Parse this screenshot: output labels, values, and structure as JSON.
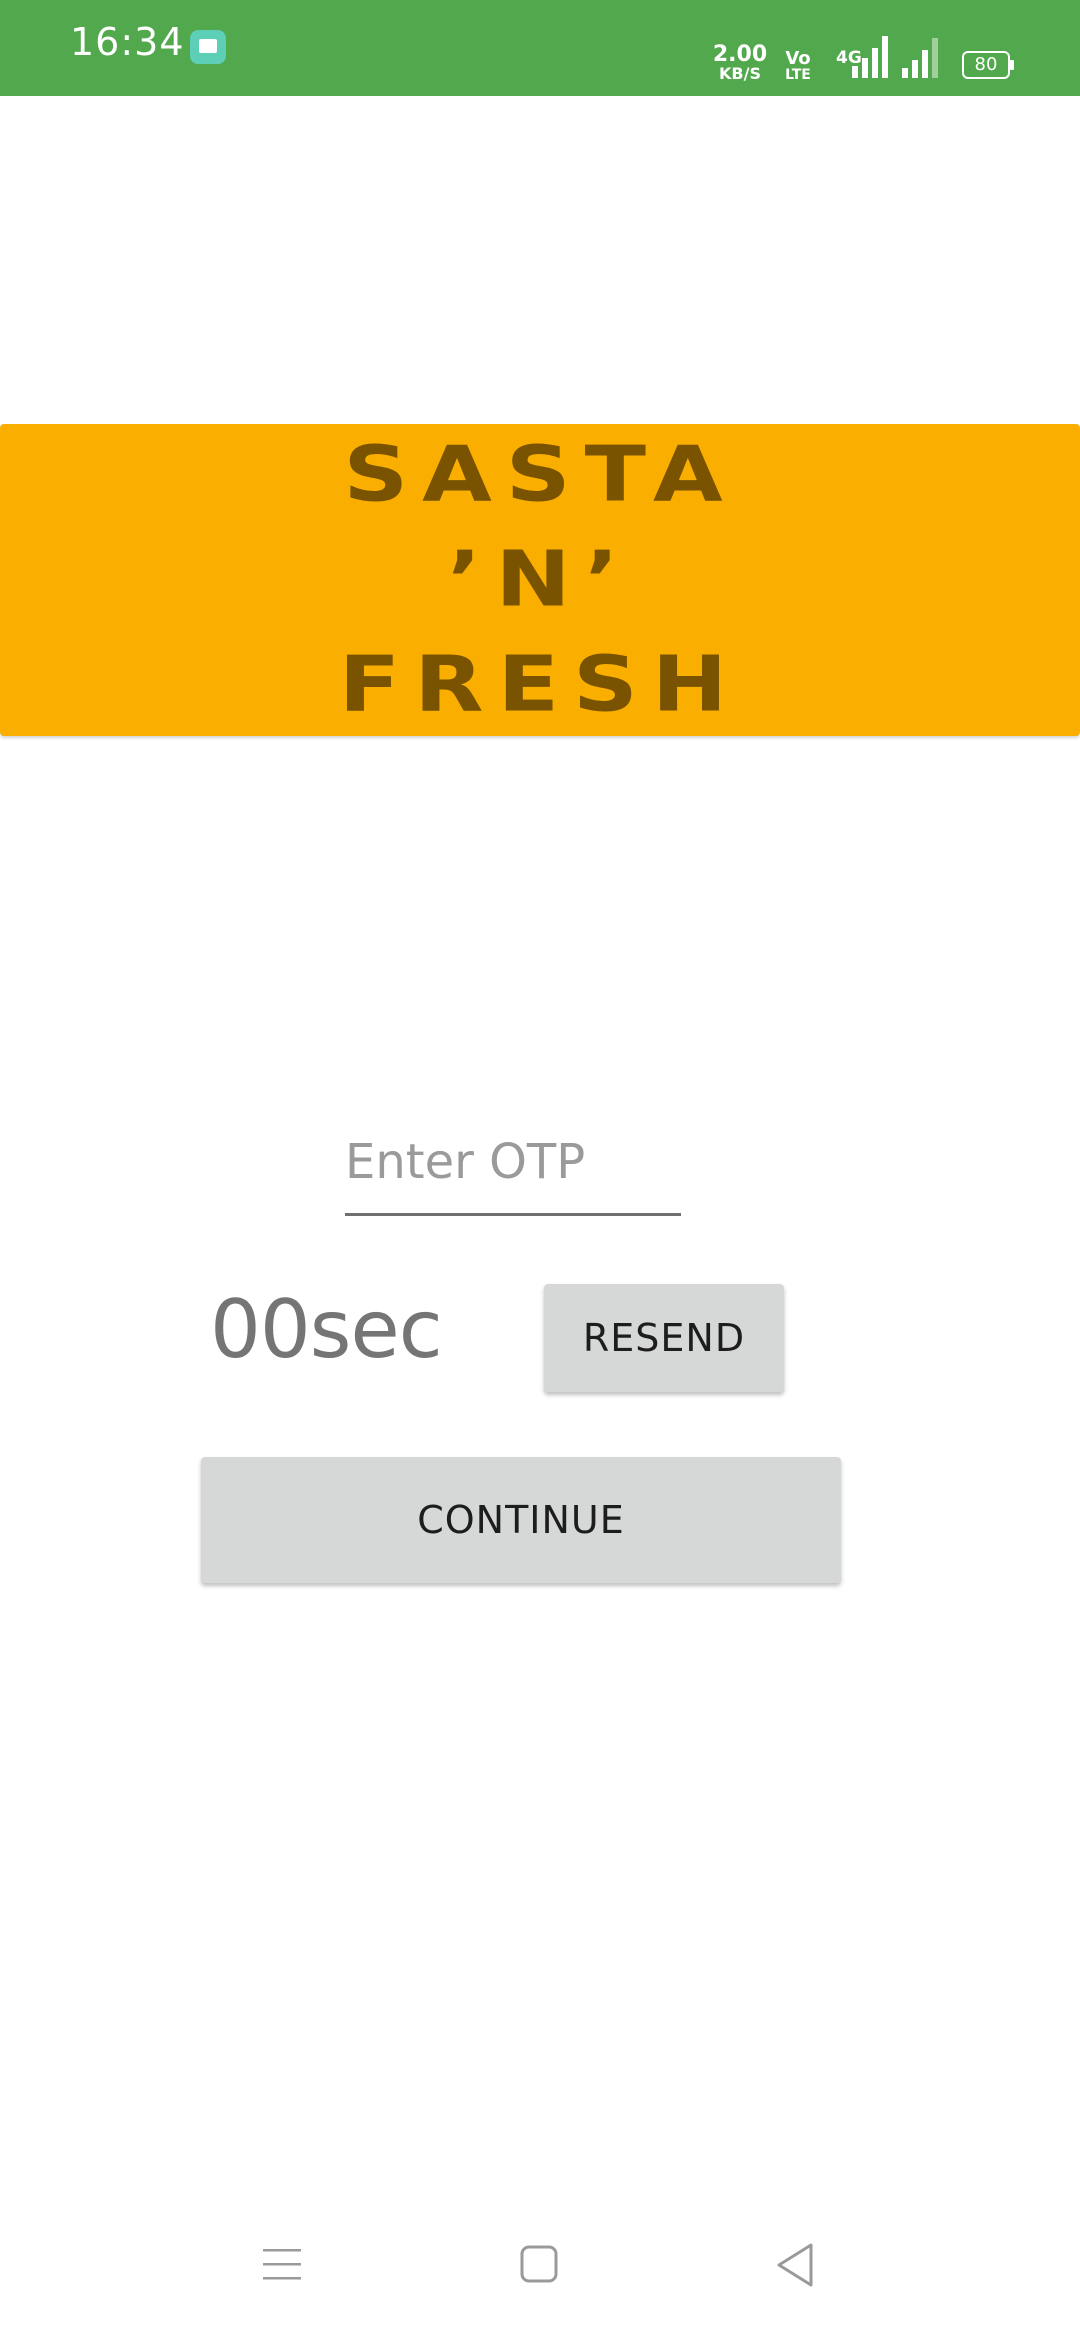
{
  "status_bar": {
    "time": "16:34",
    "net_speed_value": "2.00",
    "net_speed_unit": "KB/S",
    "volte_top": "Vo",
    "volte_bottom": "LTE",
    "network_type": "4G",
    "battery_level": "80",
    "color": "#52a84c"
  },
  "banner": {
    "line1": "SASTA",
    "line2": "’N’",
    "line3": "FRESH",
    "background_color": "#f9ae00",
    "text_color": "#7a5300"
  },
  "otp": {
    "placeholder": "Enter OTP",
    "value": ""
  },
  "timer": {
    "text": "00sec"
  },
  "buttons": {
    "resend_label": "RESEND",
    "continue_label": "CONTINUE",
    "color": "#d6d7d7"
  },
  "nav": {
    "icons": [
      "menu-icon",
      "home-icon",
      "back-icon"
    ]
  }
}
